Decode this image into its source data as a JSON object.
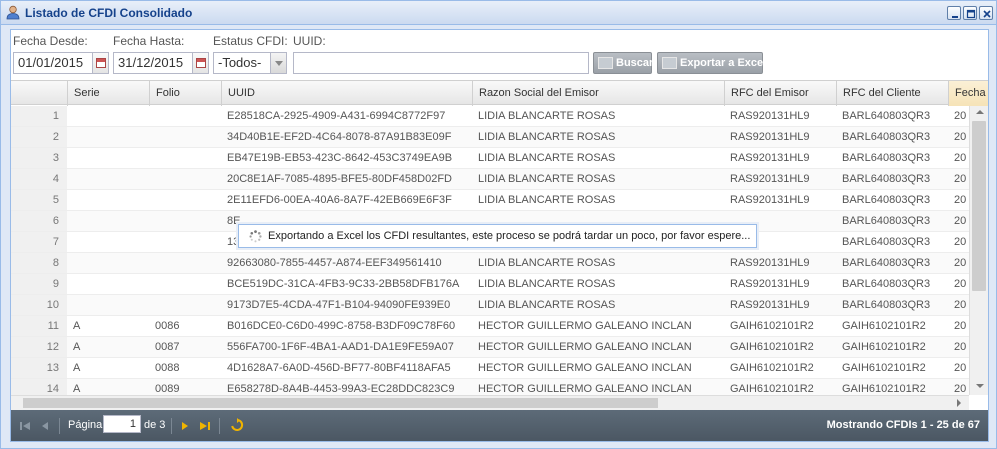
{
  "window": {
    "title": "Listado de CFDI Consolidado",
    "title_icon": "user-icon",
    "controls": [
      "minimize-icon",
      "maximize-icon",
      "close-icon"
    ]
  },
  "filters": {
    "fecha_desde_label": "Fecha Desde:",
    "fecha_desde_value": "01/01/2015",
    "fecha_hasta_label": "Fecha Hasta:",
    "fecha_hasta_value": "31/12/2015",
    "estatus_label": "Estatus CFDI:",
    "estatus_value": "-Todos-",
    "uuid_label": "UUID:",
    "uuid_value": "",
    "buscar_label": "Buscar",
    "exportar_label": "Exportar a Excel"
  },
  "grid": {
    "columns": [
      "",
      "Serie",
      "Folio",
      "UUID",
      "Razon Social del Emisor",
      "RFC del Emisor",
      "RFC del Cliente",
      "Fecha"
    ],
    "rows": [
      {
        "n": "1",
        "serie": "",
        "folio": "",
        "uuid": "E28518CA-2925-4909-A431-6994C8772F97",
        "razon": "LIDIA BLANCARTE ROSAS",
        "rfc_emisor": "RAS920131HL9",
        "rfc_cliente": "BARL640803QR3",
        "fecha": "20"
      },
      {
        "n": "2",
        "serie": "",
        "folio": "",
        "uuid": "34D40B1E-EF2D-4C64-8078-87A91B83E09F",
        "razon": "LIDIA BLANCARTE ROSAS",
        "rfc_emisor": "RAS920131HL9",
        "rfc_cliente": "BARL640803QR3",
        "fecha": "20"
      },
      {
        "n": "3",
        "serie": "",
        "folio": "",
        "uuid": "EB47E19B-EB53-423C-8642-453C3749EA9B",
        "razon": "LIDIA BLANCARTE ROSAS",
        "rfc_emisor": "RAS920131HL9",
        "rfc_cliente": "BARL640803QR3",
        "fecha": "20"
      },
      {
        "n": "4",
        "serie": "",
        "folio": "",
        "uuid": "20C8E1AF-7085-4895-BFE5-80DF458D02FD",
        "razon": "LIDIA BLANCARTE ROSAS",
        "rfc_emisor": "RAS920131HL9",
        "rfc_cliente": "BARL640803QR3",
        "fecha": "20"
      },
      {
        "n": "5",
        "serie": "",
        "folio": "",
        "uuid": "2E11EFD6-00EA-40A6-8A7F-42EB669E6F3F",
        "razon": "LIDIA BLANCARTE ROSAS",
        "rfc_emisor": "RAS920131HL9",
        "rfc_cliente": "BARL640803QR3",
        "fecha": "20"
      },
      {
        "n": "6",
        "serie": "",
        "folio": "",
        "uuid": "8E",
        "razon": "",
        "rfc_emisor": "",
        "rfc_cliente": "BARL640803QR3",
        "fecha": "20"
      },
      {
        "n": "7",
        "serie": "",
        "folio": "",
        "uuid": "13",
        "razon": "",
        "rfc_emisor": "",
        "rfc_cliente": "BARL640803QR3",
        "fecha": "20"
      },
      {
        "n": "8",
        "serie": "",
        "folio": "",
        "uuid": "92663080-7855-4457-A874-EEF349561410",
        "razon": "LIDIA BLANCARTE ROSAS",
        "rfc_emisor": "RAS920131HL9",
        "rfc_cliente": "BARL640803QR3",
        "fecha": "20"
      },
      {
        "n": "9",
        "serie": "",
        "folio": "",
        "uuid": "BCE519DC-31CA-4FB3-9C33-2BB58DFB176A",
        "razon": "LIDIA BLANCARTE ROSAS",
        "rfc_emisor": "RAS920131HL9",
        "rfc_cliente": "BARL640803QR3",
        "fecha": "20"
      },
      {
        "n": "10",
        "serie": "",
        "folio": "",
        "uuid": "9173D7E5-4CDA-47F1-B104-94090FE939E0",
        "razon": "LIDIA BLANCARTE ROSAS",
        "rfc_emisor": "RAS920131HL9",
        "rfc_cliente": "BARL640803QR3",
        "fecha": "20"
      },
      {
        "n": "11",
        "serie": "A",
        "folio": "0086",
        "uuid": "B016DCE0-C6D0-499C-8758-B3DF09C78F60",
        "razon": "HECTOR GUILLERMO GALEANO INCLAN",
        "rfc_emisor": "GAIH6102101R2",
        "rfc_cliente": "GAIH6102101R2",
        "fecha": "20"
      },
      {
        "n": "12",
        "serie": "A",
        "folio": "0087",
        "uuid": "556FA700-1F6F-4BA1-AAD1-DA1E9FE59A07",
        "razon": "HECTOR GUILLERMO GALEANO INCLAN",
        "rfc_emisor": "GAIH6102101R2",
        "rfc_cliente": "GAIH6102101R2",
        "fecha": "20"
      },
      {
        "n": "13",
        "serie": "A",
        "folio": "0088",
        "uuid": "4D1628A7-6A0D-456D-BF77-80BF4118AFA5",
        "razon": "HECTOR GUILLERMO GALEANO INCLAN",
        "rfc_emisor": "GAIH6102101R2",
        "rfc_cliente": "GAIH6102101R2",
        "fecha": "20"
      },
      {
        "n": "14",
        "serie": "A",
        "folio": "0089",
        "uuid": "E658278D-8A4B-4453-99A3-EC28DDC823C9",
        "razon": "HECTOR GUILLERMO GALEANO INCLAN",
        "rfc_emisor": "GAIH6102101R2",
        "rfc_cliente": "GAIH6102101R2",
        "fecha": "20"
      }
    ]
  },
  "pager": {
    "page_label": "Página",
    "page_value": "1",
    "of_label": "de 3",
    "status": "Mostrando CFDIs 1 - 25 de 67"
  },
  "loading": {
    "message": "Exportando a Excel los CFDI resultantes, este proceso se podrá tardar un poco, por favor espere..."
  }
}
